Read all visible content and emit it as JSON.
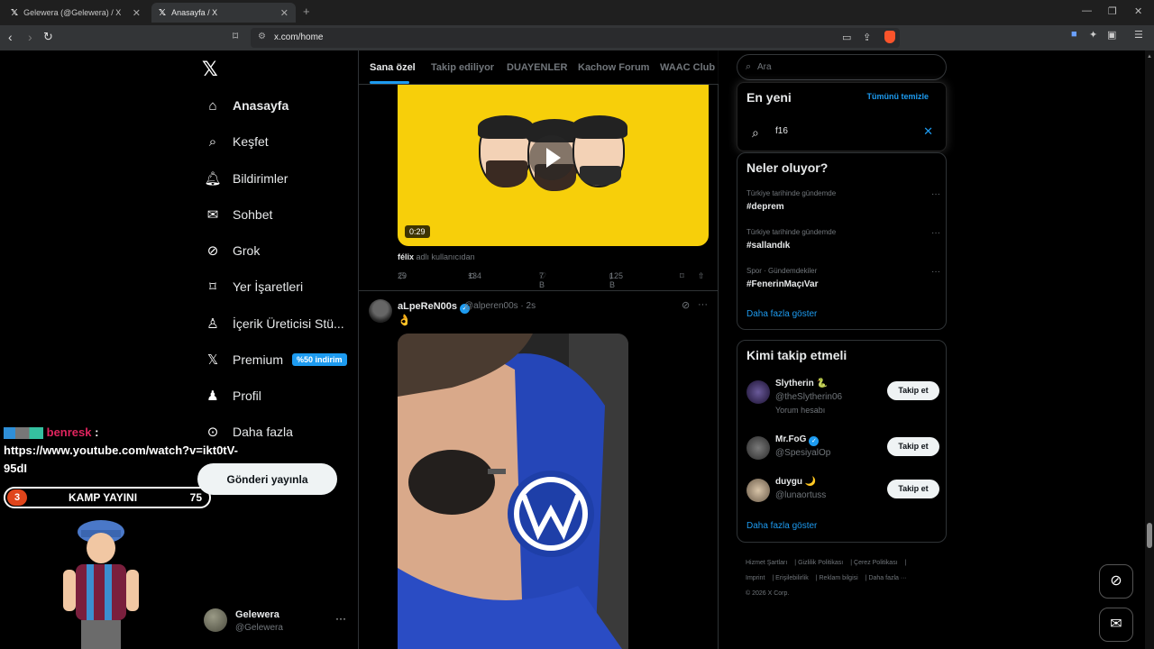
{
  "browser": {
    "tabs": [
      {
        "title": "Gelewera (@Gelewera) / X"
      },
      {
        "title": "Anasayfa / X"
      }
    ],
    "url": "x.com/home"
  },
  "nav": {
    "items": [
      {
        "label": "Anasayfa",
        "icon": "home-icon"
      },
      {
        "label": "Keşfet",
        "icon": "search-icon"
      },
      {
        "label": "Bildirimler",
        "icon": "bell-icon"
      },
      {
        "label": "Sohbet",
        "icon": "mail-icon"
      },
      {
        "label": "Grok",
        "icon": "grok-icon"
      },
      {
        "label": "Yer İşaretleri",
        "icon": "bookmark-icon"
      },
      {
        "label": "İçerik Üreticisi Stü...",
        "icon": "creator-icon"
      },
      {
        "label": "Premium",
        "icon": "x-icon",
        "badge": "%50 indirim"
      },
      {
        "label": "Profil",
        "icon": "person-icon"
      },
      {
        "label": "Daha fazla",
        "icon": "more-circle-icon"
      }
    ],
    "post_button": "Gönderi yayınla",
    "account": {
      "name": "Gelewera",
      "handle": "@Gelewera"
    }
  },
  "overlay": {
    "chat_user": "benresk",
    "chat_sep": ":",
    "chat_message": "https://www.youtube.com/watch?v=ikt0tV-95dI",
    "camp_number": "3",
    "camp_title": "KAMP YAYINI",
    "camp_count": "75"
  },
  "feed": {
    "tabs": [
      "Sana özel",
      "Takip ediliyor",
      "DUAYENLER",
      "Kachow Forum",
      "WAAC Club"
    ],
    "video_post": {
      "duration": "0:29",
      "from_user": "félix",
      "from_suffix": "adlı kullanıcıdan",
      "replies": "29",
      "reposts": "134",
      "likes": "7 B",
      "views": "125 B"
    },
    "post": {
      "name": "aLpeReN00s",
      "handle": "@alperen00s · 2s",
      "text": "👌"
    }
  },
  "sidebar": {
    "search_placeholder": "Ara",
    "recent": {
      "title": "En yeni",
      "clear": "Tümünü temizle",
      "query": "f16"
    },
    "trends": {
      "title": "Neler oluyor?",
      "items": [
        {
          "context": "Türkiye tarihinde gündemde",
          "tag": "#deprem"
        },
        {
          "context": "Türkiye tarihinde gündemde",
          "tag": "#sallandık"
        },
        {
          "context": "Spor · Gündemdekiler",
          "tag": "#FenerinMaçıVar"
        }
      ],
      "more": "Daha fazla göster"
    },
    "who_to_follow": {
      "title": "Kimi takip etmeli",
      "items": [
        {
          "name": "Slytherin 🐍",
          "handle": "@theSlytherin06",
          "sub": "Yorum hesabı",
          "button": "Takip et"
        },
        {
          "name": "Mr.FoG",
          "handle": "@SpesiyalOp",
          "button": "Takip et"
        },
        {
          "name": "duygu 🌙",
          "handle": "@lunaortuss",
          "button": "Takip et"
        }
      ],
      "more": "Daha fazla göster"
    },
    "footer": [
      "Hizmet Şartları",
      "Gizlilik Politikası",
      "Çerez Politikası",
      "Imprint",
      "Erişilebilirlik",
      "Reklam bilgisi",
      "Daha fazla ···",
      "© 2026 X Corp."
    ]
  },
  "colors": {
    "accent": "#1d9bf0",
    "background": "#000000",
    "video_bg": "#f7cf0a"
  }
}
